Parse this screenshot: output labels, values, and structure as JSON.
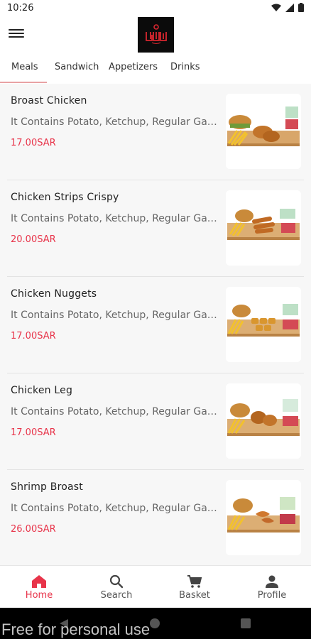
{
  "status_bar": {
    "time": "10:26"
  },
  "tabs": [
    {
      "label": "Meals",
      "active": true
    },
    {
      "label": "Sandwich",
      "active": false
    },
    {
      "label": "Appetizers",
      "active": false
    },
    {
      "label": "Drinks",
      "active": false
    }
  ],
  "menu_items": [
    {
      "name": "Broast Chicken",
      "description": "It Contains Potato, Ketchup, Regular Garlic Sauce",
      "price": "17.00SAR"
    },
    {
      "name": "Chicken Strips Crispy",
      "description": "It Contains Potato, Ketchup, Regular Garlic Sauce",
      "price": "20.00SAR"
    },
    {
      "name": "Chicken Nuggets",
      "description": "It Contains Potato, Ketchup, Regular Garlic Sauce",
      "price": "17.00SAR"
    },
    {
      "name": "Chicken Leg",
      "description": "It Contains Potato, Ketchup, Regular Garlic Sauce",
      "price": "17.00SAR"
    },
    {
      "name": "Shrimp Broast",
      "description": "It Contains Potato, Ketchup, Regular Garlic Sauce",
      "price": "26.00SAR"
    }
  ],
  "bottom_nav": [
    {
      "label": "Home",
      "icon": "home-icon",
      "active": true
    },
    {
      "label": "Search",
      "icon": "search-icon",
      "active": false
    },
    {
      "label": "Basket",
      "icon": "cart-icon",
      "active": false
    },
    {
      "label": "Profile",
      "icon": "person-icon",
      "active": false
    }
  ],
  "watermark": "Free for personal use",
  "colors": {
    "accent": "#e8344a",
    "tab_indicator": "#e8a2a4",
    "list_bg": "#f7f7f7"
  }
}
